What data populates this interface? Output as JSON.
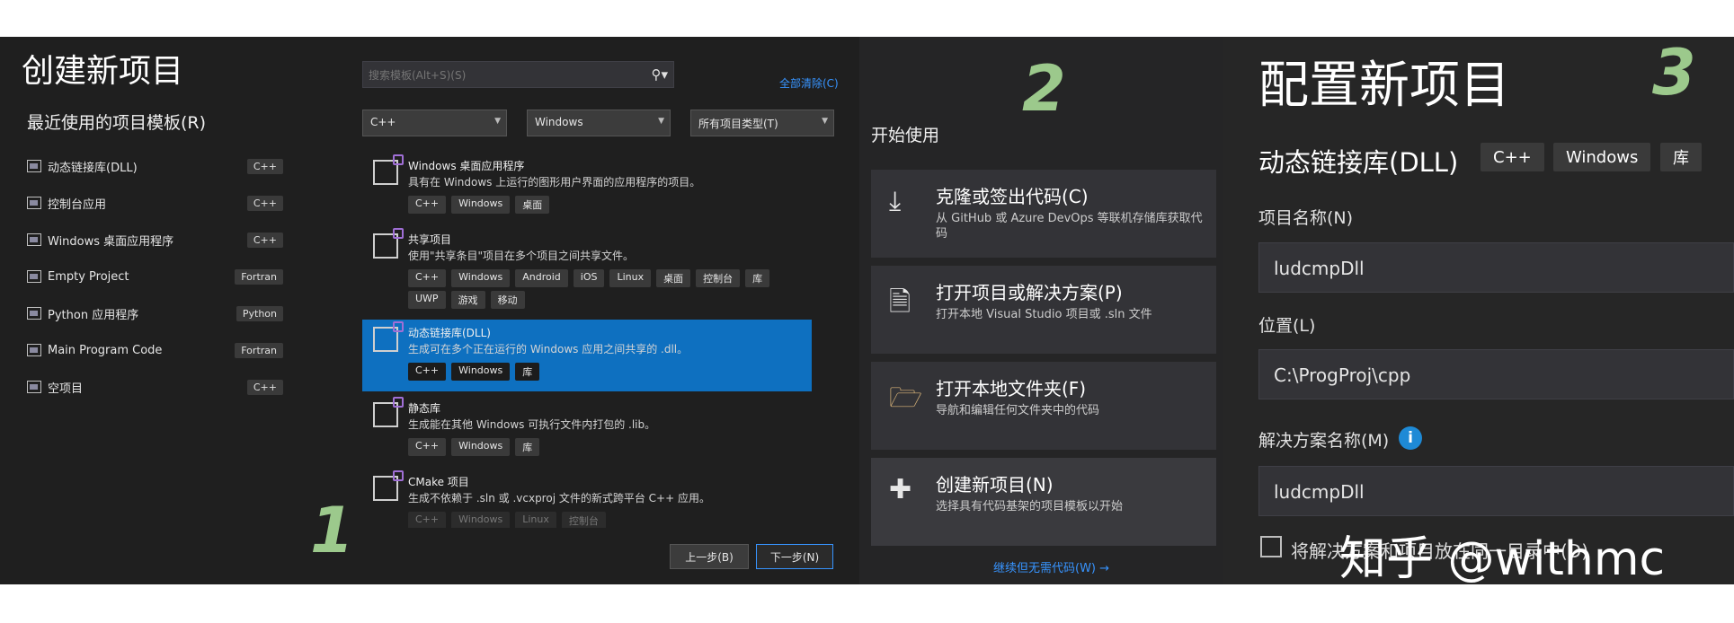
{
  "panel1": {
    "title": "创建新项目",
    "recent_heading": "最近使用的项目模板(R)",
    "recent": [
      {
        "label": "动态链接库(DLL)",
        "tag": "C++"
      },
      {
        "label": "控制台应用",
        "tag": "C++"
      },
      {
        "label": "Windows 桌面应用程序",
        "tag": "C++"
      },
      {
        "label": "Empty Project",
        "tag": "Fortran"
      },
      {
        "label": "Python 应用程序",
        "tag": "Python"
      },
      {
        "label": "Main Program Code",
        "tag": "Fortran"
      },
      {
        "label": "空项目",
        "tag": "C++"
      }
    ],
    "search_placeholder": "搜索模板(Alt+S)(S)",
    "clear_all": "全部清除(C)",
    "filters": {
      "language": "C++",
      "platform": "Windows",
      "type": "所有项目类型(T)"
    },
    "templates": [
      {
        "name": "Windows 桌面应用程序",
        "desc": "具有在 Windows 上运行的图形用户界面的应用程序的项目。",
        "tags": [
          "C++",
          "Windows",
          "桌面"
        ]
      },
      {
        "name": "共享项目",
        "desc": "使用\"共享条目\"项目在多个项目之间共享文件。",
        "tags": [
          "C++",
          "Windows",
          "Android",
          "iOS",
          "Linux",
          "桌面",
          "控制台",
          "库",
          "UWP",
          "游戏",
          "移动"
        ]
      },
      {
        "name": "动态链接库(DLL)",
        "desc": "生成可在多个正在运行的 Windows 应用之间共享的 .dll。",
        "tags": [
          "C++",
          "Windows",
          "库"
        ]
      },
      {
        "name": "静态库",
        "desc": "生成能在其他 Windows 可执行文件内打包的 .lib。",
        "tags": [
          "C++",
          "Windows",
          "库"
        ]
      },
      {
        "name": "CMake 项目",
        "desc": "生成不依赖于 .sln 或 .vcxproj 文件的新式跨平台 C++ 应用。",
        "tags": [
          "C++",
          "Windows",
          "Linux",
          "控制台"
        ]
      }
    ],
    "prev_button": "上一步(B)",
    "next_button": "下一步(N)",
    "step": "1"
  },
  "panel2": {
    "step": "2",
    "heading": "开始使用",
    "cards": [
      {
        "title": "克隆或签出代码(C)",
        "desc": "从 GitHub 或 Azure DevOps 等联机存储库获取代码"
      },
      {
        "title": "打开项目或解决方案(P)",
        "desc": "打开本地 Visual Studio 项目或 .sln 文件"
      },
      {
        "title": "打开本地文件夹(F)",
        "desc": "导航和编辑任何文件夹中的代码"
      },
      {
        "title": "创建新项目(N)",
        "desc": "选择具有代码基架的项目模板以开始"
      }
    ],
    "continue_link": "继续但无需代码(W) →"
  },
  "panel3": {
    "step": "3",
    "title": "配置新项目",
    "template_name": "动态链接库(DLL)",
    "tags": [
      "C++",
      "Windows",
      "库"
    ],
    "project_name_label": "项目名称(N)",
    "project_name": "ludcmpDll",
    "location_label": "位置(L)",
    "location": "C:\\ProgProj\\cpp",
    "solution_name_label": "解决方案名称(M)",
    "solution_name": "ludcmpDll",
    "checkbox_label": "将解决方案和项目放在同一目录中(D)"
  },
  "watermark": "知乎 @withmc"
}
